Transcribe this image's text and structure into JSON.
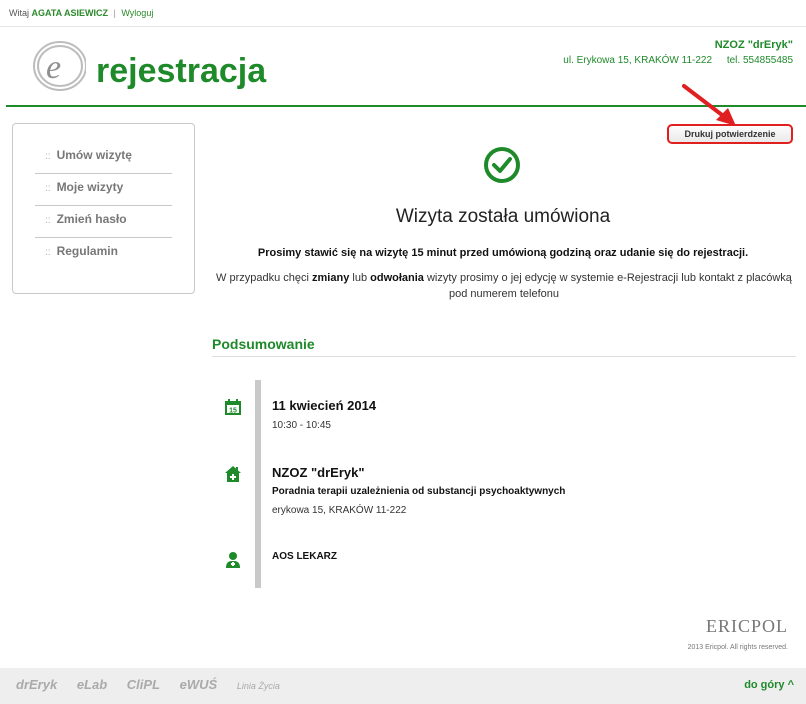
{
  "topbar": {
    "greeting": "Witaj",
    "user": "AGATA ASIEWICZ",
    "separator": "|",
    "logout": "Wyloguj"
  },
  "brand": {
    "logo_text": "rejestracja",
    "logo_letter": "e"
  },
  "clinic": {
    "name": "NZOZ \"drEryk\"",
    "address": "ul. Erykowa 15, KRAKÓW 11-222",
    "phone": "tel. 554855485"
  },
  "sidebar": {
    "items": [
      {
        "bullet": "::",
        "label": "Umów wizytę"
      },
      {
        "bullet": "::",
        "label": "Moje wizyty"
      },
      {
        "bullet": "::",
        "label": "Zmień hasło"
      },
      {
        "bullet": "::",
        "label": "Regulamin"
      }
    ]
  },
  "actions": {
    "print_label": "Drukuj potwierdzenie"
  },
  "confirmation": {
    "headline": "Wizyta została umówiona",
    "notice": "Prosimy stawić się na wizytę 15 minut przed umówioną godziną oraz udanie się do rejestracji.",
    "info_part1": "W przypadku chęci ",
    "info_bold1": "zmiany",
    "info_part2": " lub ",
    "info_bold2": "odwołania",
    "info_part3": " wizyty prosimy o jej edycję w systemie e-Rejestracji lub kontakt z placówką pod numerem telefonu"
  },
  "summary": {
    "title": "Podsumowanie",
    "date": "11 kwiecień 2014",
    "time": "10:30 - 10:45",
    "calendar_day": "15",
    "facility_name": "NZOZ \"drEryk\"",
    "facility_unit": "Poradnia terapii uzależnienia od substancji psychoaktywnych",
    "facility_address": "erykowa 15, KRAKÓW 11-222",
    "doctor": "AOS LEKARZ"
  },
  "footer": {
    "company_logo": "ERICPOL",
    "copyright": "2013 Ericpol. All rights reserved.",
    "product_logos": [
      "drEryk",
      "eLab",
      "CliPL",
      "eWUŚ",
      "Linia Życia"
    ],
    "back_to_top": "do góry ^"
  },
  "icons": {
    "check": "check-circle-icon",
    "calendar": "calendar-icon",
    "clinic": "clinic-house-icon",
    "doctor": "doctor-icon",
    "arrow": "red-arrow-icon"
  },
  "colors": {
    "brand_green": "#1f8a2a",
    "highlight_red": "#e02020",
    "logo_grey": "#9a9a9a"
  }
}
